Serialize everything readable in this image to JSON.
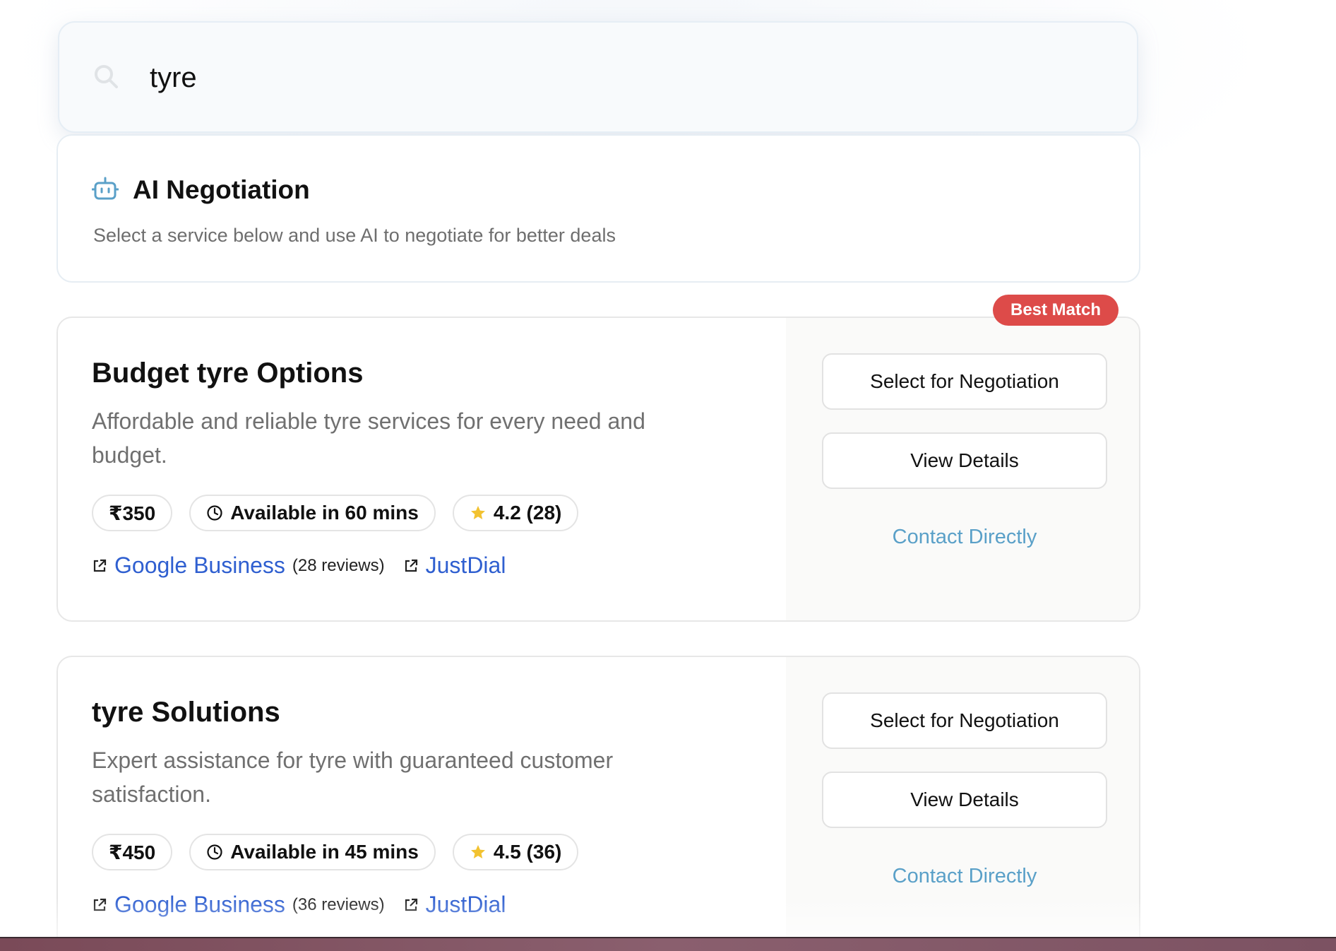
{
  "search": {
    "value": "tyre"
  },
  "ai_panel": {
    "title": "AI Negotiation",
    "subtitle": "Select a service below and use AI to negotiate for better deals"
  },
  "badge": {
    "best_match": "Best Match"
  },
  "colors": {
    "accent_blue": "#5aa0c8",
    "link_blue": "#2f5fd0",
    "badge_red": "#dd4b49",
    "star_yellow": "#f2c230"
  },
  "services": [
    {
      "title": "Budget tyre Options",
      "description": "Affordable and reliable tyre services for every need and budget.",
      "price": "₹350",
      "availability": "Available in 60 mins",
      "rating": "4.2 (28)",
      "google_label": "Google Business",
      "google_reviews": "(28 reviews)",
      "justdial_label": "JustDial",
      "select_label": "Select for Negotiation",
      "view_label": "View Details",
      "contact_label": "Contact Directly"
    },
    {
      "title": "tyre Solutions",
      "description": "Expert assistance for tyre with guaranteed customer satisfaction.",
      "price": "₹450",
      "availability": "Available in 45 mins",
      "rating": "4.5 (36)",
      "google_label": "Google Business",
      "google_reviews": "(36 reviews)",
      "justdial_label": "JustDial",
      "select_label": "Select for Negotiation",
      "view_label": "View Details",
      "contact_label": "Contact Directly"
    }
  ]
}
